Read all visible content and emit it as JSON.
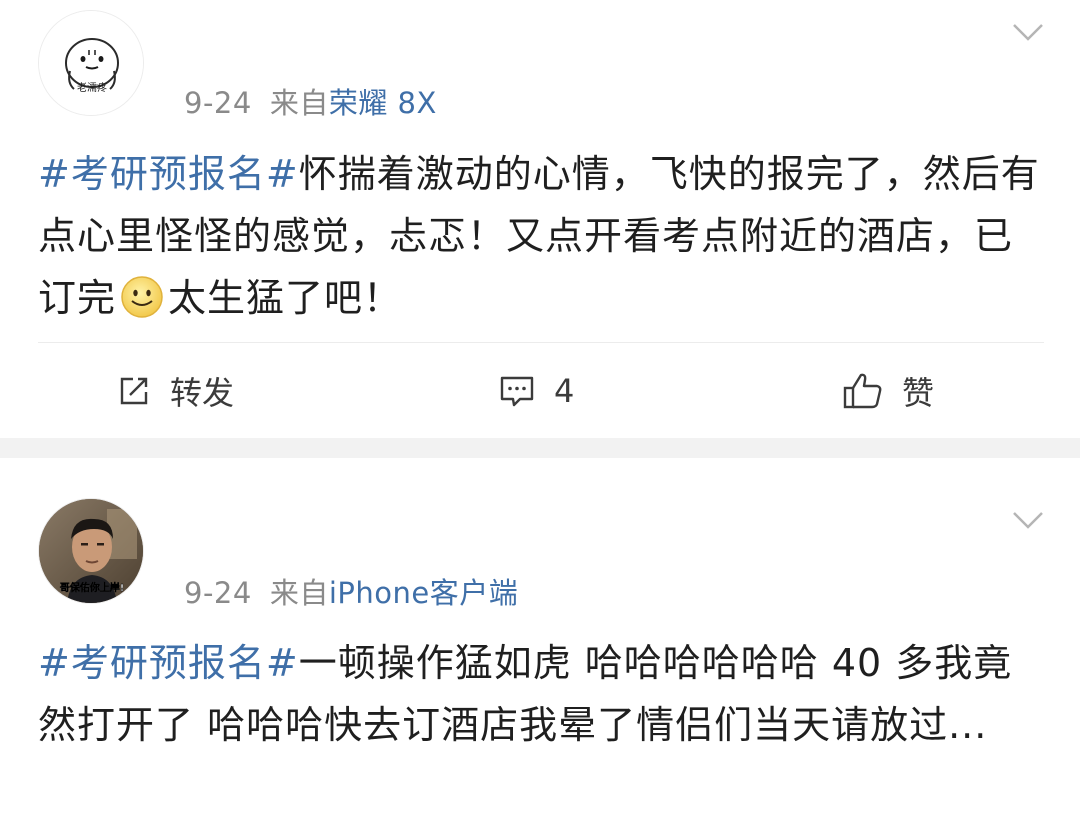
{
  "posts": [
    {
      "avatar_label": "老濡疼",
      "date": "9-24",
      "from": "来自",
      "source": "荣耀 8X",
      "topic": "#考研预报名#",
      "text_part1": "怀揣着激动的心情，飞快的报完了，然后有点心里怪怪的感觉，忐忑！又点开看考点附近的酒店，已订完",
      "emoji": "smile-emoji",
      "text_part2": "太生猛了吧！",
      "actions": {
        "repost_label": "转发",
        "comment_count": "4",
        "like_label": "赞"
      }
    },
    {
      "avatar_label": "哥保佑你上岸!",
      "date": "9-24",
      "from": "来自",
      "source": "iPhone客户端",
      "topic": "#考研预报名#",
      "text": "一顿操作猛如虎 哈哈哈哈哈哈 40 多我竟然打开了 哈哈哈快去订酒店我晕了情侣们当天请放过..."
    }
  ],
  "colors": {
    "link": "#3f6fa8",
    "meta": "#8a8a8a",
    "divider": "#f2f2f2"
  }
}
